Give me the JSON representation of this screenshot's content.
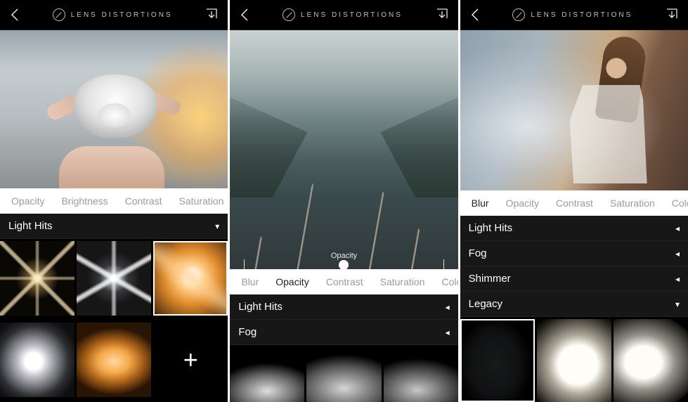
{
  "app": {
    "name": "LENS DISTORTIONS"
  },
  "screen1": {
    "adjust_tabs": [
      "Opacity",
      "Brightness",
      "Contrast",
      "Saturation"
    ],
    "active_tab_index": -1,
    "effect_category": "Light Hits",
    "category_arrow": "▾",
    "add_label": "+"
  },
  "screen2": {
    "opacity_label": "Opacity",
    "adjust_tabs": [
      "Blur",
      "Opacity",
      "Contrast",
      "Saturation",
      "Color"
    ],
    "active_tab_index": 1,
    "categories": [
      {
        "label": "Light Hits",
        "arrow": "◂"
      },
      {
        "label": "Fog",
        "arrow": "◂"
      }
    ]
  },
  "screen3": {
    "adjust_tabs": [
      "Blur",
      "Opacity",
      "Contrast",
      "Saturation",
      "Color"
    ],
    "active_tab_index": 0,
    "categories": [
      {
        "label": "Light Hits",
        "arrow": "◂"
      },
      {
        "label": "Fog",
        "arrow": "◂"
      },
      {
        "label": "Shimmer",
        "arrow": "◂"
      },
      {
        "label": "Legacy",
        "arrow": "▾"
      }
    ]
  }
}
